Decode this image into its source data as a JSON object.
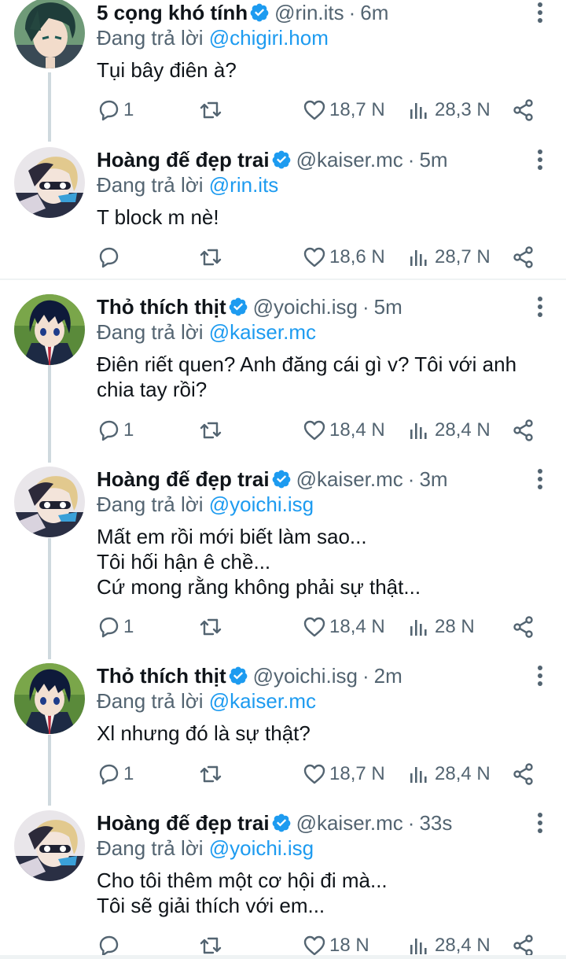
{
  "colors": {
    "accent": "#1d9bf0",
    "text": "#0f1419",
    "muted": "#536471"
  },
  "icons": {
    "verified": "verified-badge-icon",
    "more": "more-icon",
    "reply": "reply-icon",
    "retweet": "retweet-icon",
    "like": "heart-icon",
    "views": "views-icon",
    "share": "share-icon"
  },
  "tweets": [
    {
      "name": "5 cọng khó tính",
      "handle": "@rin.its",
      "dot": "·",
      "time": "6m",
      "reply_prefix": "Đang trả lời ",
      "reply_to": "@chigiri.hom",
      "lines": [
        "Tụi bây điên à?"
      ],
      "replies": "1",
      "retweets": "",
      "likes": "18,7 N",
      "views": "28,3 N"
    },
    {
      "name": "Hoàng đế đẹp trai",
      "handle": "@kaiser.mc",
      "dot": "·",
      "time": "5m",
      "reply_prefix": "Đang trả lời ",
      "reply_to": "@rin.its",
      "lines": [
        "T block m nè!"
      ],
      "replies": "",
      "retweets": "",
      "likes": "18,6 N",
      "views": "28,7 N"
    },
    {
      "name": "Thỏ thích thịt",
      "handle": "@yoichi.isg",
      "dot": "·",
      "time": "5m",
      "reply_prefix": "Đang trả lời ",
      "reply_to": "@kaiser.mc",
      "lines": [
        "Điên riết quen? Anh đăng cái gì v? Tôi với anh",
        "chia tay rồi?"
      ],
      "replies": "1",
      "retweets": "",
      "likes": "18,4 N",
      "views": "28,4 N"
    },
    {
      "name": "Hoàng đế đẹp trai",
      "handle": "@kaiser.mc",
      "dot": "·",
      "time": "3m",
      "reply_prefix": "Đang trả lời ",
      "reply_to": "@yoichi.isg",
      "lines": [
        "Mất em rồi mới biết làm sao...",
        "Tôi hối hận ê chề...",
        "Cứ mong rằng không phải sự thật..."
      ],
      "replies": "1",
      "retweets": "",
      "likes": "18,4 N",
      "views": "28 N"
    },
    {
      "name": "Thỏ thích thịt",
      "handle": "@yoichi.isg",
      "dot": "·",
      "time": "2m",
      "reply_prefix": "Đang trả lời ",
      "reply_to": "@kaiser.mc",
      "lines": [
        "Xl nhưng đó là sự thật?"
      ],
      "replies": "1",
      "retweets": "",
      "likes": "18,7 N",
      "views": "28,4 N"
    },
    {
      "name": "Hoàng đế đẹp trai",
      "handle": "@kaiser.mc",
      "dot": "·",
      "time": "33s",
      "reply_prefix": "Đang trả lời ",
      "reply_to": "@yoichi.isg",
      "lines": [
        "Cho tôi thêm một cơ hội đi mà...",
        "Tôi sẽ giải thích với em..."
      ],
      "replies": "",
      "retweets": "",
      "likes": "18 N",
      "views": "28,4 N"
    }
  ]
}
